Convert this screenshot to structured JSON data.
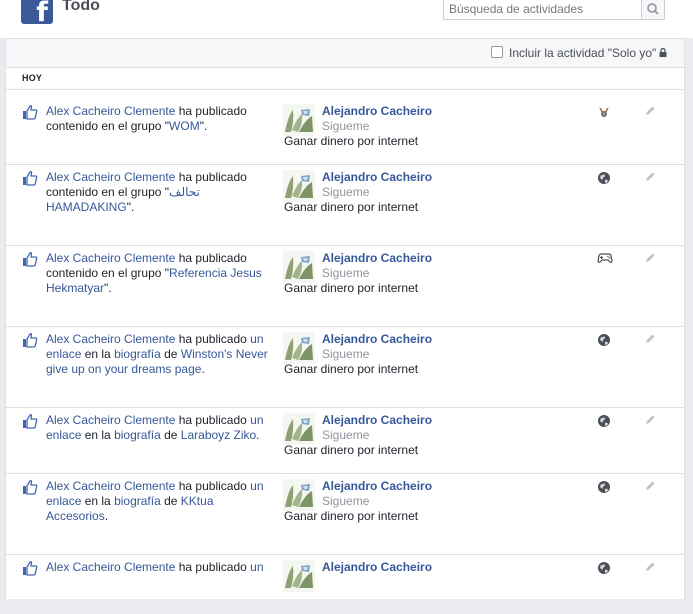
{
  "header": {
    "title": "Todo",
    "search_placeholder": "Búsqueda de actividades"
  },
  "filter": {
    "checkbox_label": "Incluir la actividad \"Solo yo\""
  },
  "section_label": "HOY",
  "colors": {
    "accent": "#3b5998",
    "link": "#365899",
    "muted": "#90949c"
  },
  "rows": [
    {
      "actor": "Alex Cacheiro Clemente",
      "parts": [
        " ha publicado contenido en el grupo \"",
        "WOM",
        "\"."
      ],
      "page_title": "Alejandro Cacheiro",
      "follow": "Sigueme",
      "category": "Ganar dinero por internet",
      "audience_icon": "custom-audience-icon"
    },
    {
      "actor": "Alex Cacheiro Clemente",
      "parts": [
        " ha publicado contenido en el grupo \"",
        "تحالف HAMADAKING",
        "\"."
      ],
      "page_title": "Alejandro Cacheiro",
      "follow": "Sigueme",
      "category": "Ganar dinero por internet",
      "audience_icon": "globe-icon"
    },
    {
      "actor": "Alex Cacheiro Clemente",
      "parts": [
        " ha publicado contenido en el grupo \"",
        "Referencia Jesus Hekmatyar",
        "\"."
      ],
      "page_title": "Alejandro Cacheiro",
      "follow": "Sigueme",
      "category": "Ganar dinero por internet",
      "audience_icon": "gamepad-icon"
    },
    {
      "actor": "Alex Cacheiro Clemente",
      "parts": [
        " ha publicado ",
        "un enlace",
        " en la ",
        "biografía",
        " de ",
        "Winston's Never give up on your dreams page",
        "."
      ],
      "page_title": "Alejandro Cacheiro",
      "follow": "Sigueme",
      "category": "Ganar dinero por internet",
      "audience_icon": "globe-icon"
    },
    {
      "actor": "Alex Cacheiro Clemente",
      "parts": [
        " ha publicado ",
        "un enlace",
        " en la ",
        "biografía",
        " de ",
        "Laraboyz Ziko",
        "."
      ],
      "page_title": "Alejandro Cacheiro",
      "follow": "Sigueme",
      "category": "Ganar dinero por internet",
      "audience_icon": "globe-icon"
    },
    {
      "actor": "Alex Cacheiro Clemente",
      "parts": [
        " ha publicado ",
        "un enlace",
        " en la ",
        "biografía",
        " de ",
        "KKtua Accesorios",
        "."
      ],
      "page_title": "Alejandro Cacheiro",
      "follow": "Sigueme",
      "category": "Ganar dinero por internet",
      "audience_icon": "globe-icon"
    },
    {
      "actor": "Alex Cacheiro Clemente",
      "parts": [
        " ha publicado ",
        "un"
      ],
      "page_title": "Alejandro Cacheiro",
      "follow": "",
      "category": "",
      "audience_icon": "globe-icon"
    }
  ]
}
